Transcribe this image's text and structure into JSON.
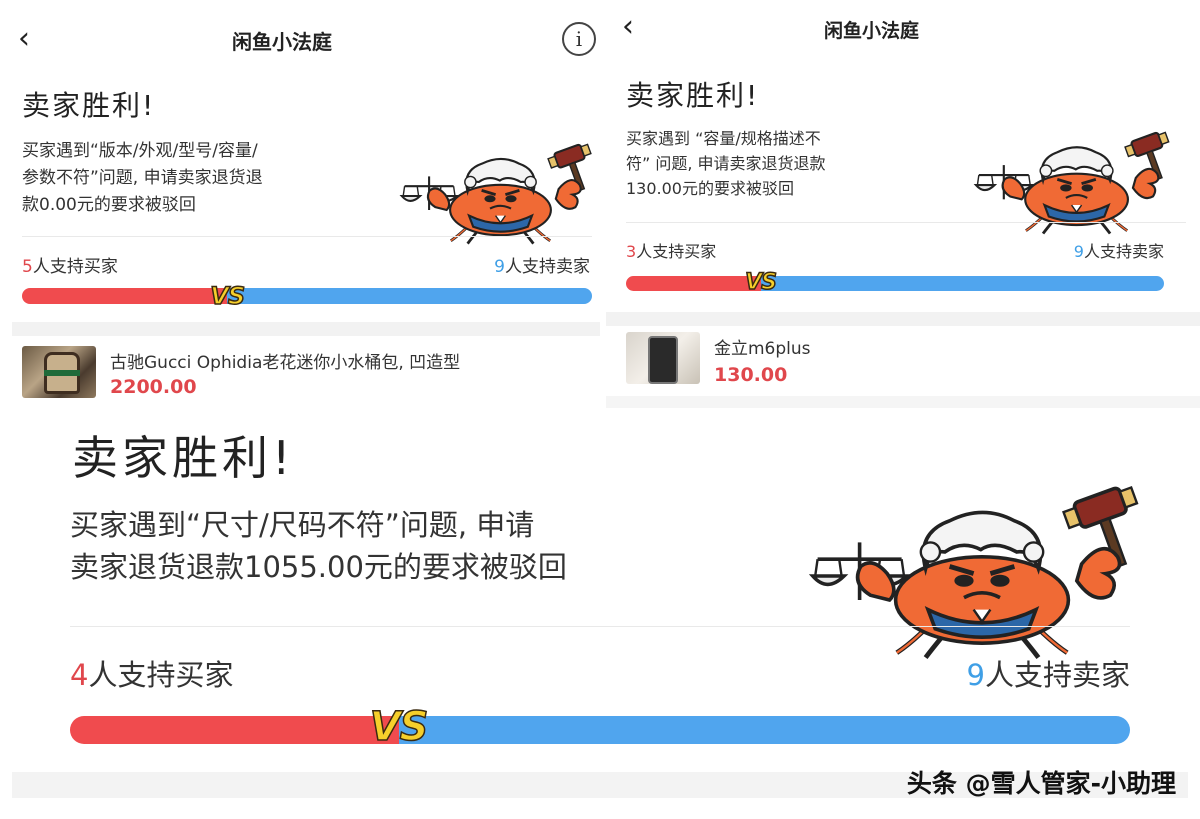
{
  "colors": {
    "buyer_red": "#f04b4e",
    "seller_blue": "#50a5ee",
    "price_red": "#e0474c",
    "vs_yellow": "#f6cf2b"
  },
  "panel1": {
    "nav": {
      "back_icon": "chevron-left-icon",
      "title": "闲鱼小法庭",
      "info_icon": "info-circle-icon",
      "info_glyph": "i"
    },
    "verdict": "卖家胜利!",
    "desc_lines": [
      "买家遇到“版本/外观/型号/容量/",
      "参数不符”问题, 申请卖家退货退",
      "款0.00元的要求被驳回"
    ],
    "buyer_count": "5",
    "buyer_text": "人支持买家",
    "seller_count": "9",
    "seller_text": "人支持卖家",
    "buyer_share": 0.36,
    "vs": "VS",
    "product": {
      "title": "古驰Gucci Ophidia老花迷你小水桶包, 凹造型",
      "price": "2200.00"
    }
  },
  "panel2": {
    "nav": {
      "back_icon": "chevron-left-icon",
      "title": "闲鱼小法庭"
    },
    "verdict": "卖家胜利!",
    "desc_lines": [
      "买家遇到 “容量/规格描述不",
      "符” 问题, 申请卖家退货退款",
      "130.00元的要求被驳回"
    ],
    "buyer_count": "3",
    "buyer_text": "人支持买家",
    "seller_count": "9",
    "seller_text": "人支持卖家",
    "buyer_share": 0.25,
    "vs": "VS",
    "product": {
      "title": "金立m6plus",
      "price": "130.00"
    }
  },
  "panel3": {
    "verdict": "卖家胜利!",
    "desc_lines": [
      "买家遇到“尺寸/尺码不符”问题, 申请",
      "卖家退货退款1055.00元的要求被驳回"
    ],
    "buyer_count": "4",
    "buyer_text": "人支持买家",
    "seller_count": "9",
    "seller_text": "人支持卖家",
    "buyer_share": 0.31,
    "vs": "VS"
  },
  "watermark": "头条 @雪人管家-小助理",
  "mascot_icon": "crab-judge-icon"
}
